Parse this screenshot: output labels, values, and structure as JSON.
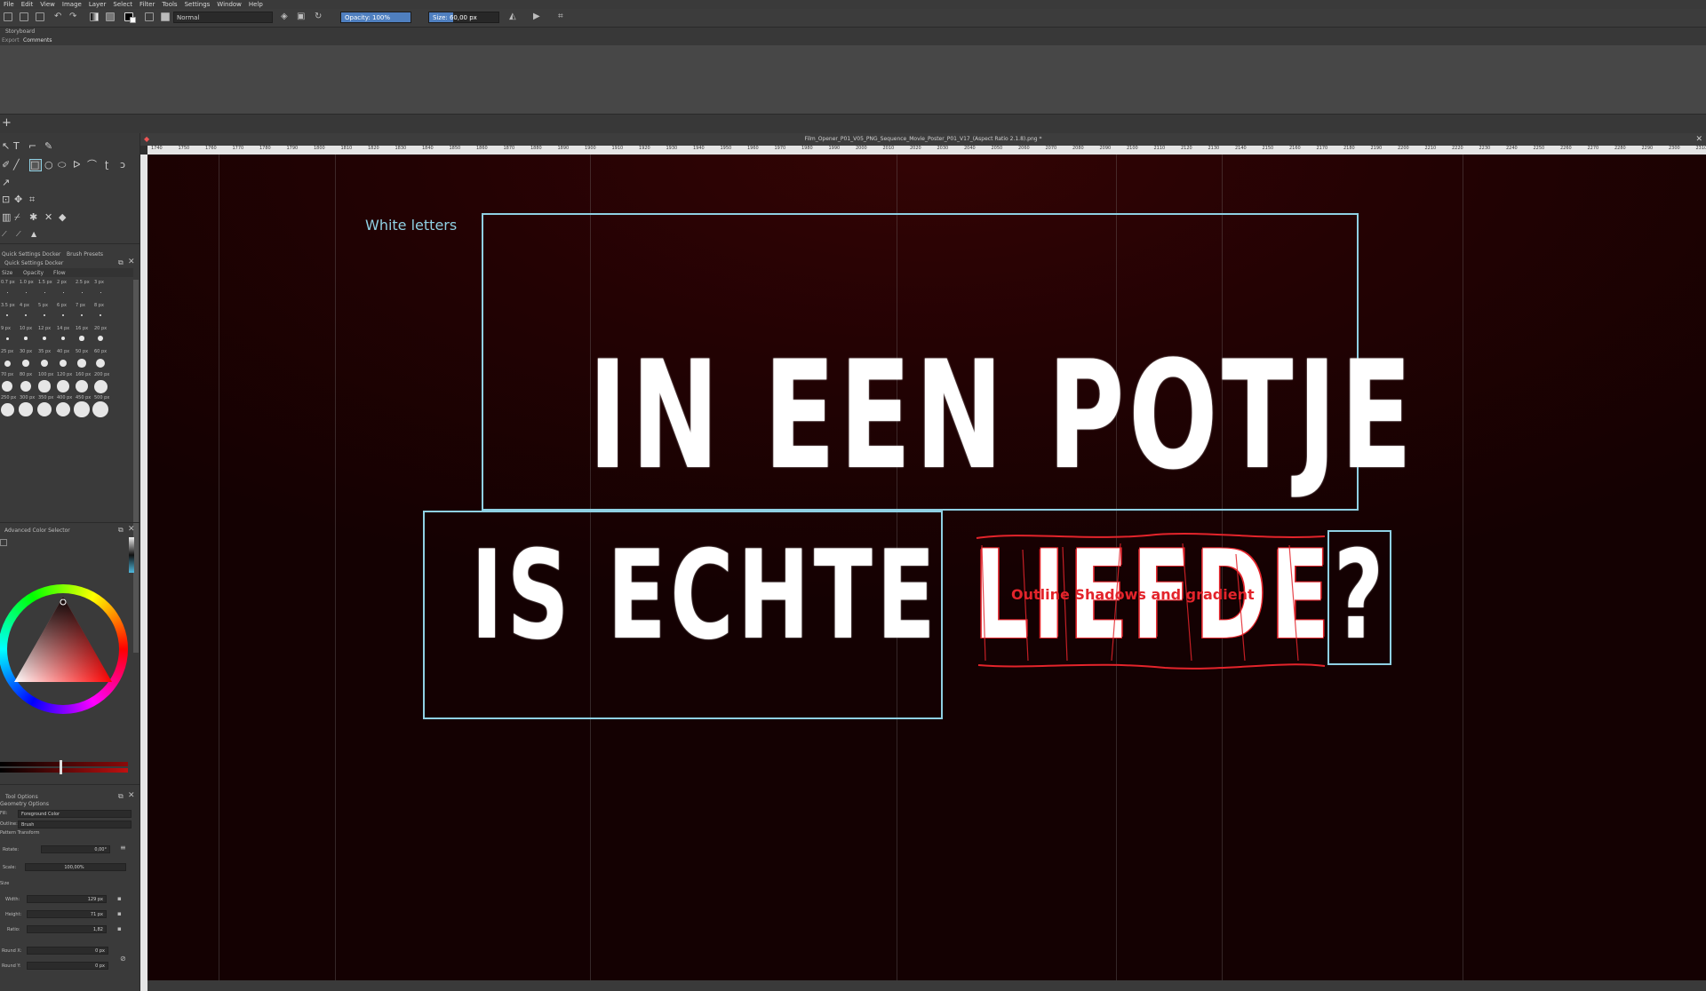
{
  "menu": [
    "File",
    "Edit",
    "View",
    "Image",
    "Layer",
    "Select",
    "Filter",
    "Tools",
    "Settings",
    "Window",
    "Help"
  ],
  "toolbar": {
    "blend_mode": "Normal",
    "opacity": "Opacity: 100%",
    "opacity_fraction": 1.0,
    "size": "Size: 60,00 px",
    "size_fraction": 0.35
  },
  "dock": {
    "row1": "Storyboard",
    "tab_a": "Export",
    "tab_b": "Comments"
  },
  "quick_settings": {
    "tab1": "Quick Settings Docker",
    "tab2": "Brush Presets",
    "title": "Quick Settings Docker",
    "subtabs": [
      "Size",
      "Opacity",
      "Flow"
    ],
    "sizes": [
      [
        "0.7 px",
        "1.0 px",
        "1.5 px",
        "2 px",
        "2.5 px",
        "3 px"
      ],
      [
        "3.5 px",
        "4 px",
        "5 px",
        "6 px",
        "7 px",
        "8 px"
      ],
      [
        "9 px",
        "10 px",
        "12 px",
        "14 px",
        "16 px",
        "20 px"
      ],
      [
        "25 px",
        "30 px",
        "35 px",
        "40 px",
        "50 px",
        "60 px"
      ],
      [
        "70 px",
        "80 px",
        "100 px",
        "120 px",
        "160 px",
        "200 px"
      ],
      [
        "250 px",
        "300 px",
        "350 px",
        "400 px",
        "450 px",
        "500 px"
      ]
    ]
  },
  "color_selector": {
    "title": "Advanced Color Selector"
  },
  "tool_options": {
    "title": "Tool Options",
    "geometry": "Geometry Options",
    "fill_label": "Fill:",
    "fill_value": "Foreground Color",
    "outline_label": "Outline:",
    "outline_value": "Brush",
    "pattern": "Pattern Transform",
    "rotate_label": "Rotate:",
    "rotate_value": "0,00°",
    "scale_label": "Scale:",
    "scale_value": "100,00%",
    "size_label": "Size",
    "width_label": "Width:",
    "width_value": "129 px",
    "height_label": "Height:",
    "height_value": "71 px",
    "ratio_label": "Ratio:",
    "ratio_value": "1,82",
    "roundx_label": "Round X:",
    "roundx_value": "0 px",
    "roundy_label": "Round Y:",
    "roundy_value": "0 px"
  },
  "document": {
    "title": "Film_Opener_P01_V05_PNG_Sequence_Movie_Poster_P01_V17_(Aspect Ratio 2.1.8).png *",
    "ruler_ticks": [
      "1740",
      "1750",
      "1760",
      "1770",
      "1780",
      "1790",
      "1800",
      "1810",
      "1820",
      "1830",
      "1840",
      "1850",
      "1860",
      "1870",
      "1880",
      "1890",
      "1900",
      "1910",
      "1920",
      "1930",
      "1940",
      "1950",
      "1960",
      "1970",
      "1980",
      "1990",
      "2000",
      "2010",
      "2020",
      "2030",
      "2040",
      "2050",
      "2060",
      "2070",
      "2080",
      "2090",
      "2100",
      "2110",
      "2120",
      "2130",
      "2140",
      "2150",
      "2160",
      "2170",
      "2180",
      "2190",
      "2200",
      "2210",
      "2220",
      "2230",
      "2240",
      "2250",
      "2260",
      "2270",
      "2280",
      "2290",
      "2300",
      "2310"
    ]
  },
  "poster": {
    "line1": "IN EEN POTJE",
    "line2a": "IS ECHTE",
    "line2b": "LIEFDE",
    "qmark": "?",
    "note_white": "White letters",
    "note_outline": "Outline Shadows and gradient",
    "colors": {
      "box": "#8fd0e3",
      "red": "#e3242b",
      "bg": "#230203"
    }
  }
}
